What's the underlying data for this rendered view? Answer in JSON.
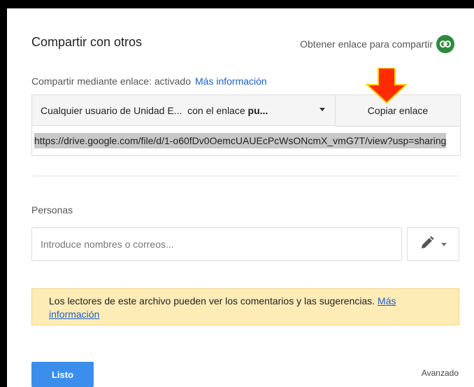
{
  "dialog": {
    "title": "Compartir con otros",
    "get_link_label": "Obtener enlace para compartir",
    "link_status": "Compartir mediante enlace: activado",
    "more_info": "Más información",
    "access_dropdown": {
      "prefix": "Cualquier usuario de Unidad E...  con el enlace ",
      "bold": "pu..."
    },
    "copy_link_label": "Copiar enlace",
    "url": "https://drive.google.com/file/d/1-o60fDv0OemcUAUEcPcWsONcmX_vmG7T/view?usp=sharing",
    "people_label": "Personas",
    "people_placeholder": "Introduce nombres o correos...",
    "notice_text": "Los lectores de este archivo pueden ver los comentarios y las sugerencias.",
    "notice_link": "Más información",
    "done_label": "Listo",
    "advanced_label": "Avanzado"
  },
  "colors": {
    "link_icon_bg": "#2e8b3c",
    "primary_button": "#3b8eec",
    "notice_bg": "#fdecb6",
    "annotation_arrow": "#ff2a00"
  },
  "icons": [
    "link-icon",
    "pencil-icon",
    "chevron-down-icon",
    "red-arrow-annotation"
  ]
}
